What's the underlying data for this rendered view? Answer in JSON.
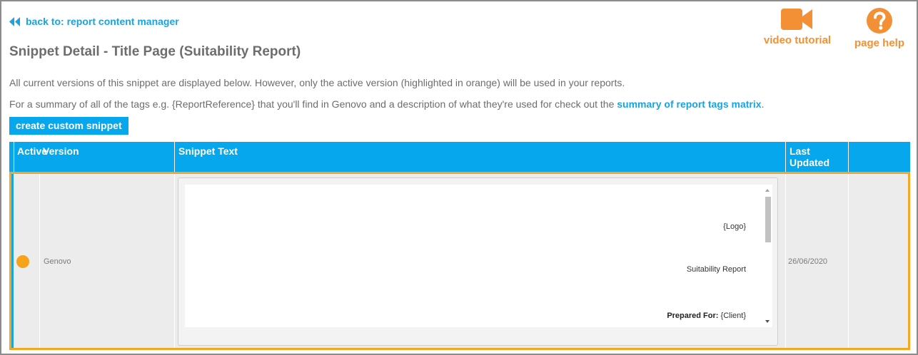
{
  "nav": {
    "back_label": "back to: report content manager"
  },
  "page": {
    "title": "Snippet Detail - Title Page (Suitability Report)"
  },
  "help": {
    "video_label": "video tutorial",
    "help_label": "page help",
    "video_icon": "video-camera-icon",
    "help_icon": "question-circle-icon"
  },
  "intro": {
    "line1": "All current versions of this snippet are displayed below. However, only the active version (highlighted in orange) will be used in your reports.",
    "line2_prefix": "For a summary of all of the tags e.g. {ReportReference} that you'll find in Genovo and a description of what they're used for check out the ",
    "line2_link": "summary of report tags matrix",
    "line2_suffix": "."
  },
  "actions": {
    "create_label": "create custom snippet"
  },
  "table": {
    "headers": {
      "active": "Active",
      "version": "Version",
      "snippet": "Snippet Text",
      "updated_line1": "Last",
      "updated_line2": "Updated"
    },
    "rows": [
      {
        "active": true,
        "version": "Genovo",
        "last_updated": "26/06/2020",
        "snippet_lines": {
          "logo": "{Logo}",
          "report": "Suitability Report",
          "prepared_label": "Prepared For:",
          "prepared_value": "{Client}"
        }
      }
    ]
  },
  "colors": {
    "accent_blue": "#06a7ec",
    "link_blue": "#1aa3e0",
    "orange": "#f39035",
    "active_dot": "#f7a21b",
    "highlight_border": "#f5a623"
  }
}
